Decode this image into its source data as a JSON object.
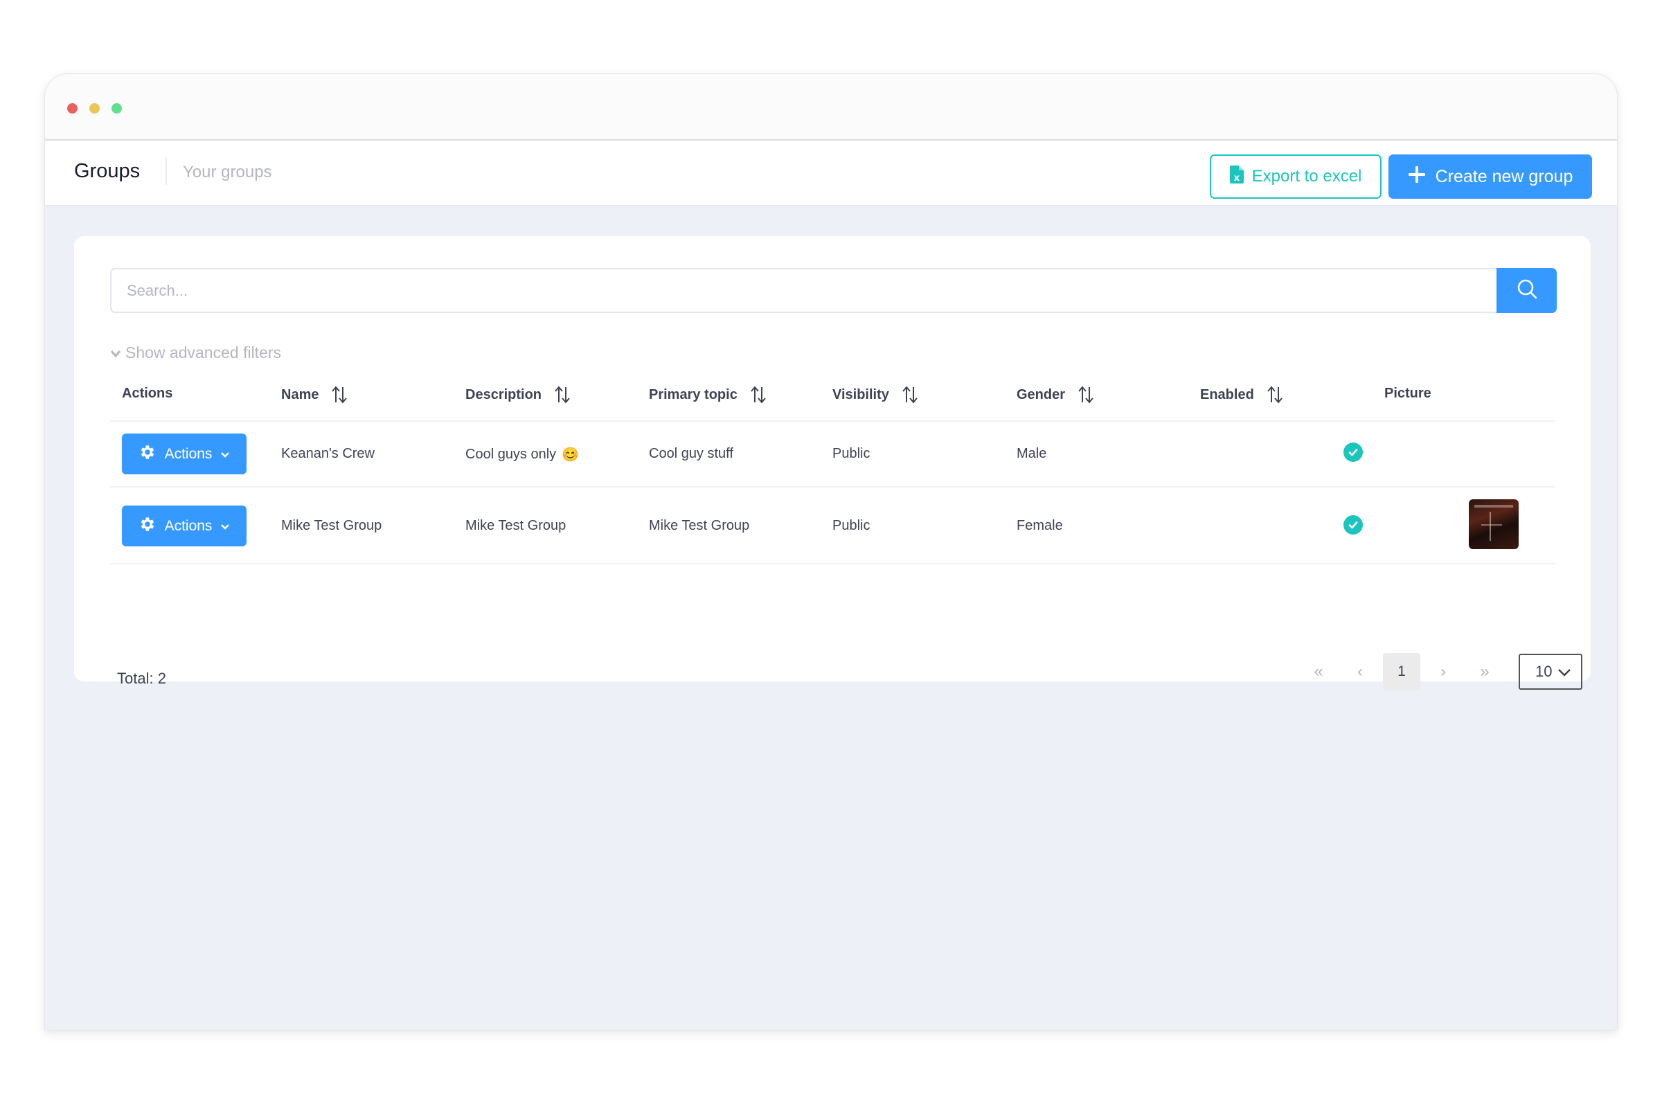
{
  "window": {
    "controls": [
      "close",
      "minimize",
      "maximize"
    ]
  },
  "header": {
    "title": "Groups",
    "subtitle": "Your groups",
    "export_label": "Export to excel",
    "create_label": "Create new group"
  },
  "search": {
    "placeholder": "Search...",
    "value": ""
  },
  "filters": {
    "toggle_label": "Show advanced filters"
  },
  "table": {
    "columns": [
      "Actions",
      "Name",
      "Description",
      "Primary topic",
      "Visibility",
      "Gender",
      "Enabled",
      "Picture"
    ],
    "rows": [
      {
        "action_label": "Actions",
        "name": "Keanan's Crew",
        "description": "Cool guys only",
        "description_emoji": "😊",
        "primary_topic": "Cool guy stuff",
        "visibility": "Public",
        "gender": "Male",
        "enabled": true,
        "picture": false
      },
      {
        "action_label": "Actions",
        "name": "Mike Test Group",
        "description": "Mike Test Group",
        "description_emoji": "",
        "primary_topic": "Mike Test Group",
        "visibility": "Public",
        "gender": "Female",
        "enabled": true,
        "picture": true
      }
    ]
  },
  "footer": {
    "total_label": "Total: 2",
    "pagination": {
      "first": "«",
      "prev": "‹",
      "current_page": "1",
      "next": "›",
      "last": "»"
    },
    "page_size": "10"
  },
  "colors": {
    "primary": "#3699ff",
    "success": "#1bc5bd",
    "muted": "#b5b5c3",
    "text": "#3f4254"
  }
}
